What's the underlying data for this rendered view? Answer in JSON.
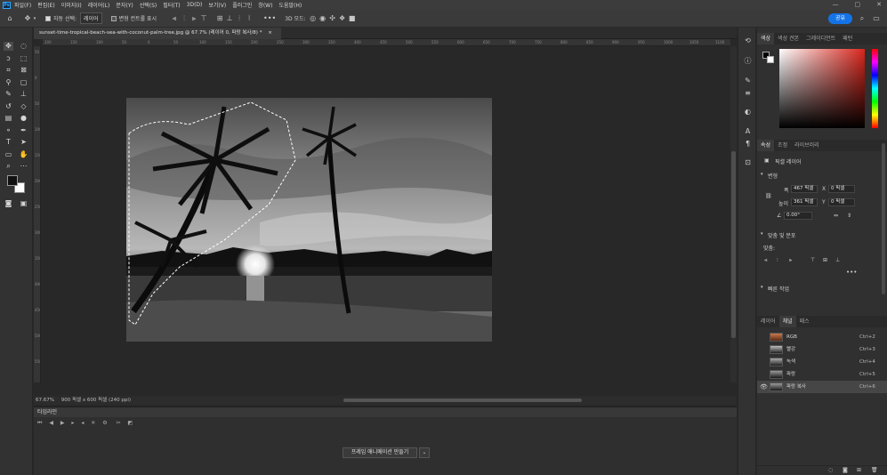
{
  "menubar": {
    "app_icon": "Ps",
    "items": [
      "파일(F)",
      "편집(E)",
      "이미지(I)",
      "레이어(L)",
      "문자(Y)",
      "선택(S)",
      "필터(T)",
      "3D(D)",
      "보기(V)",
      "플러그인",
      "창(W)",
      "도움말(H)"
    ],
    "window_controls": [
      "—",
      "▢",
      "✕"
    ]
  },
  "options": {
    "auto_select_label": "자동 선택:",
    "auto_select_value": "레이어",
    "transform_label": "변형 컨트롤 표시",
    "more": "•••",
    "mode_label": "3D 모드:",
    "share_label": "공유"
  },
  "document": {
    "tab_title": "sunset-time-tropical-beach-sea-with-coconut-palm-tree.jpg @ 67.7% (레이어 0, 파랑 복사/8) *",
    "close": "×",
    "ruler_marks": [
      "200",
      "150",
      "100",
      "50",
      "0",
      "50",
      "100",
      "150",
      "200",
      "250",
      "300",
      "350",
      "400",
      "450",
      "500",
      "550",
      "600",
      "650",
      "700",
      "750",
      "800",
      "850",
      "900",
      "950",
      "1000",
      "1050",
      "1100"
    ],
    "zoom": "67.67%",
    "size_info": "900 픽셀 x 600 픽셀 (240 ppi)"
  },
  "timeline": {
    "title": "타임라인",
    "create_button": "프레임 애니메이션 만들기",
    "caret": "⌄"
  },
  "color_panel": {
    "tabs": [
      "색상",
      "색상 견본",
      "그레이디언트",
      "패턴"
    ],
    "accent": "#d9261c"
  },
  "properties_panel": {
    "tabs": [
      "속성",
      "조정",
      "라이브러리"
    ],
    "layer_type": "픽셀 레이어",
    "transform_title": "변형",
    "w_label": "폭",
    "w_value": "467 픽셀",
    "x_label": "X",
    "x_value": "0 픽셀",
    "h_label": "높이",
    "h_value": "361 픽셀",
    "y_label": "Y",
    "y_value": "0 픽셀",
    "angle_value": "0.00°",
    "align_title": "맞춤 및 분포",
    "align_sub": "맞춤:",
    "more": "•••",
    "quick_title": "빠른 작업"
  },
  "channels_panel": {
    "tabs": [
      "레이어",
      "채널",
      "패스"
    ],
    "rows": [
      {
        "name": "RGB",
        "shortcut": "Ctrl+2"
      },
      {
        "name": "빨강",
        "shortcut": "Ctrl+3"
      },
      {
        "name": "녹색",
        "shortcut": "Ctrl+4"
      },
      {
        "name": "파랑",
        "shortcut": "Ctrl+5"
      },
      {
        "name": "파랑 복사",
        "shortcut": "Ctrl+6"
      }
    ]
  }
}
